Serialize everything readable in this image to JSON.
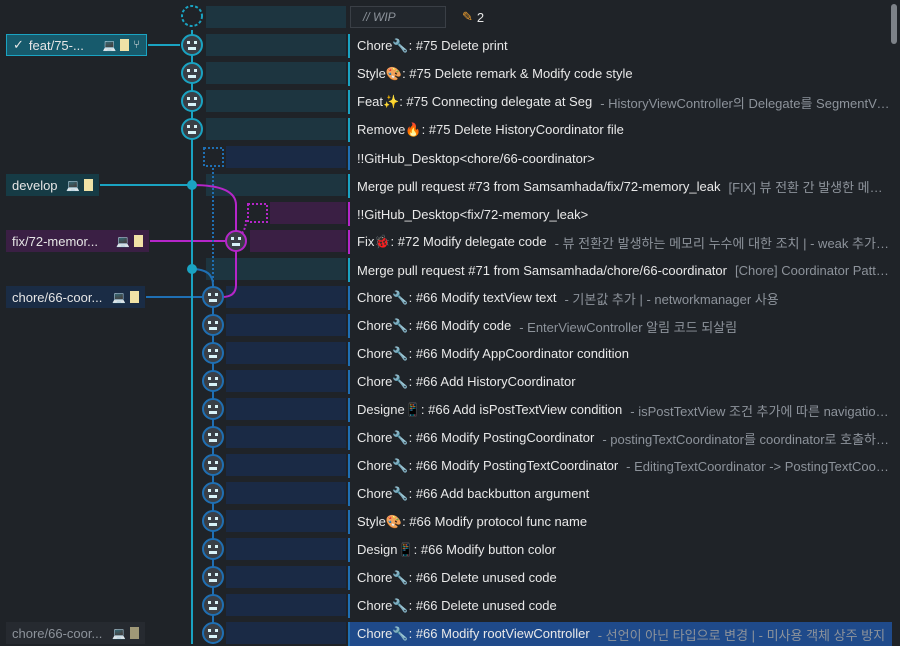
{
  "wip": {
    "placeholder": "// WIP",
    "count": "2",
    "icon": "pencil-icon"
  },
  "refs": [
    {
      "label": "feat/75-...",
      "check": "✓",
      "style": "current"
    },
    {
      "label": "develop",
      "style": "teal"
    },
    {
      "label": "fix/72-memor...",
      "style": "purple"
    },
    {
      "label": "chore/66-coor...",
      "style": "blue"
    },
    {
      "label": "chore/66-coor...",
      "style": "dim"
    }
  ],
  "commits": [
    {
      "msg": "Chore🔧: #75 Delete print",
      "desc": ""
    },
    {
      "msg": "Style🎨: #75 Delete remark & Modify code style",
      "desc": ""
    },
    {
      "msg": "Feat✨: #75 Connecting delegate at Seg",
      "desc": "- HistoryViewController의 Delegate를 SegmentViewCo..."
    },
    {
      "msg": "Remove🔥: #75 Delete HistoryCoordinator file",
      "desc": ""
    },
    {
      "msg": "!!GitHub_Desktop<chore/66-coordinator>",
      "desc": ""
    },
    {
      "msg": "Merge pull request #73 from Samsamhada/fix/72-memory_leak",
      "desc": "[FIX] 뷰 전환 간 발생한 메모리 누..."
    },
    {
      "msg": "!!GitHub_Desktop<fix/72-memory_leak>",
      "desc": ""
    },
    {
      "msg": "Fix🐞: #72 Modify delegate code",
      "desc": "- 뷰 전환간 발생하는 메모리 누수에 대한 조치 | - weak 추가 | - class ..."
    },
    {
      "msg": "Merge pull request #71 from Samsamhada/chore/66-coordinator",
      "desc": "[Chore] Coordinator Patter..."
    },
    {
      "msg": "Chore🔧: #66 Modify textView text",
      "desc": "- 기본값 추가 | - networkmanager 사용"
    },
    {
      "msg": "Chore🔧: #66 Modify code",
      "desc": "- EnterViewController 알림 코드 되살림"
    },
    {
      "msg": "Chore🔧: #66 Modify AppCoordinator condition",
      "desc": ""
    },
    {
      "msg": "Chore🔧: #66 Add HistoryCoordinator",
      "desc": ""
    },
    {
      "msg": "Designe📱: #66 Add isPostTextView condition",
      "desc": "- isPostTextView 조건 추가에 따른 navigation 및 버..."
    },
    {
      "msg": "Chore🔧: #66 Modify PostingCoordinator",
      "desc": "- postingTextCoordinator를 coordinator로 호출하여, P..."
    },
    {
      "msg": "Chore🔧: #66 Modify PostingTextCoordinator",
      "desc": "- EditingTextCoordinator -> PostingTextCoordin..."
    },
    {
      "msg": "Chore🔧: #66 Add backbutton argument",
      "desc": ""
    },
    {
      "msg": "Style🎨: #66 Modify protocol func name",
      "desc": ""
    },
    {
      "msg": "Design📱: #66 Modify button color",
      "desc": ""
    },
    {
      "msg": "Chore🔧: #66 Delete unused code",
      "desc": ""
    },
    {
      "msg": "Chore🔧: #66 Delete unused code",
      "desc": ""
    },
    {
      "msg": "Chore🔧: #66 Modify rootViewController",
      "desc": "- 선언이 아닌 타입으로 변경 | - 미사용 객체 상주 방지"
    }
  ],
  "colors": {
    "teal": "#1aa3c2",
    "purple": "#b526c9",
    "blue": "#1f6fb3",
    "selected": "#1f4a8a"
  }
}
